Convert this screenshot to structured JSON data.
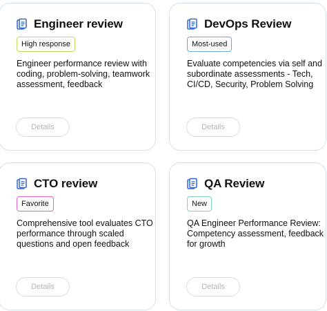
{
  "colors": {
    "accent": "#2f63d6",
    "card_border": "#cfe3f5",
    "high_response_border": "#b8dd62",
    "most_used_border": "#6aa6e0",
    "favorite_border": "#e262c8",
    "new_border": "#7fd3b6"
  },
  "cards": [
    {
      "icon": "document-icon",
      "title": "Engineer review",
      "badge": "High response",
      "description": "Engineer performance review with coding, problem-solving, teamwork assessment, feedback",
      "button": "Details"
    },
    {
      "icon": "document-icon",
      "title": "DevOps Review",
      "badge": "Most-used",
      "description": "Evaluate competencies via self and subordinate assessments - Tech, CI/CD, Security, Problem Solving",
      "button": "Details"
    },
    {
      "icon": "document-icon",
      "title": "CTO review",
      "badge": "Favorite",
      "description": "Comprehensive tool evaluates CTO performance through scaled questions and open feedback",
      "button": "Details"
    },
    {
      "icon": "document-icon",
      "title": "QA Review",
      "badge": "New",
      "description": "QA Engineer Performance Review: Competency assessment, feedback for growth",
      "button": "Details"
    }
  ]
}
